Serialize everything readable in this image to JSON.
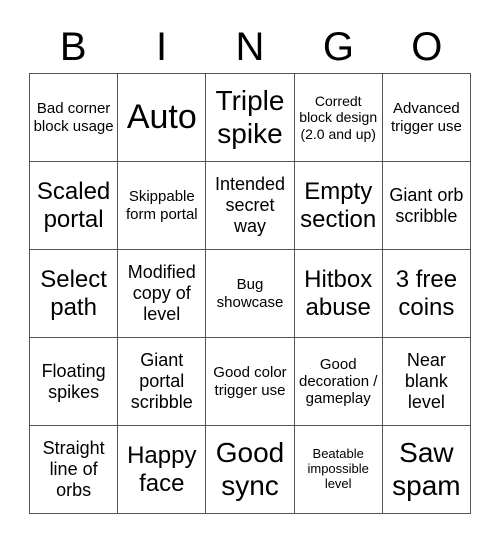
{
  "header": [
    "B",
    "I",
    "N",
    "G",
    "O"
  ],
  "cells": [
    [
      "Bad corner block usage",
      "Auto",
      "Triple spike",
      "Corredt block design (2.0 and up)",
      "Advanced trigger use"
    ],
    [
      "Scaled portal",
      "Skippable form portal",
      "Intended secret way",
      "Empty section",
      "Giant orb scribble"
    ],
    [
      "Select path",
      "Modified copy of level",
      "Bug showcase",
      "Hitbox abuse",
      "3 free coins"
    ],
    [
      "Floating spikes",
      "Giant portal scribble",
      "Good color trigger use",
      "Good decoration / gameplay",
      "Near blank level"
    ],
    [
      "Straight line of orbs",
      "Happy face",
      "Good sync",
      "Beatable impossible level",
      "Saw spam"
    ]
  ]
}
